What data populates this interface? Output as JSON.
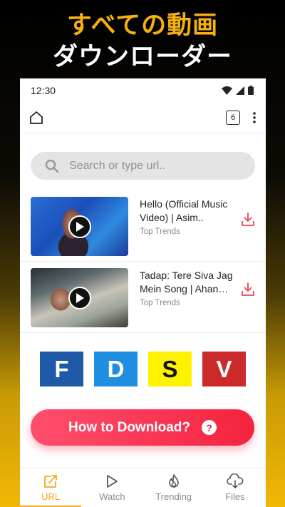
{
  "headline": {
    "line1": "すべての動画",
    "line2": "ダウンローダー"
  },
  "status_bar": {
    "time": "12:30",
    "icons": [
      "wifi-icon",
      "signal-icon",
      "battery-icon"
    ]
  },
  "toolbar": {
    "tab_count": "6",
    "icons": [
      "home-icon",
      "more-vertical-icon"
    ]
  },
  "search": {
    "placeholder": "Search or type url.."
  },
  "videos": [
    {
      "title": "Hello (Official Music Video) | Asim..",
      "subtitle": "Top Trends"
    },
    {
      "title": "Tadap: Tere Siva Jag Mein Song | Ahan…",
      "subtitle": "Top Trends"
    }
  ],
  "quick_buttons": [
    {
      "label": "F",
      "bg": "#1e5aa8",
      "fg": "#ffffff"
    },
    {
      "label": "D",
      "bg": "#1e8ee0",
      "fg": "#ffffff"
    },
    {
      "label": "S",
      "bg": "#fff200",
      "fg": "#111111"
    },
    {
      "label": "V",
      "bg": "#cc2a2a",
      "fg": "#ffffff"
    }
  ],
  "cta": {
    "label": "How to Download?",
    "icon": "question-icon"
  },
  "bottom_nav": [
    {
      "label": "URL",
      "icon": "external-link-icon",
      "active": true
    },
    {
      "label": "Watch",
      "icon": "play-icon",
      "active": false
    },
    {
      "label": "Trending",
      "icon": "flame-icon",
      "active": false
    },
    {
      "label": "Files",
      "icon": "download-cloud-icon",
      "active": false
    }
  ],
  "colors": {
    "accent": "#f6a61a",
    "cta": "#f5223e",
    "download_icon": "#e8484f",
    "headline_yellow": "#f6b10c"
  }
}
